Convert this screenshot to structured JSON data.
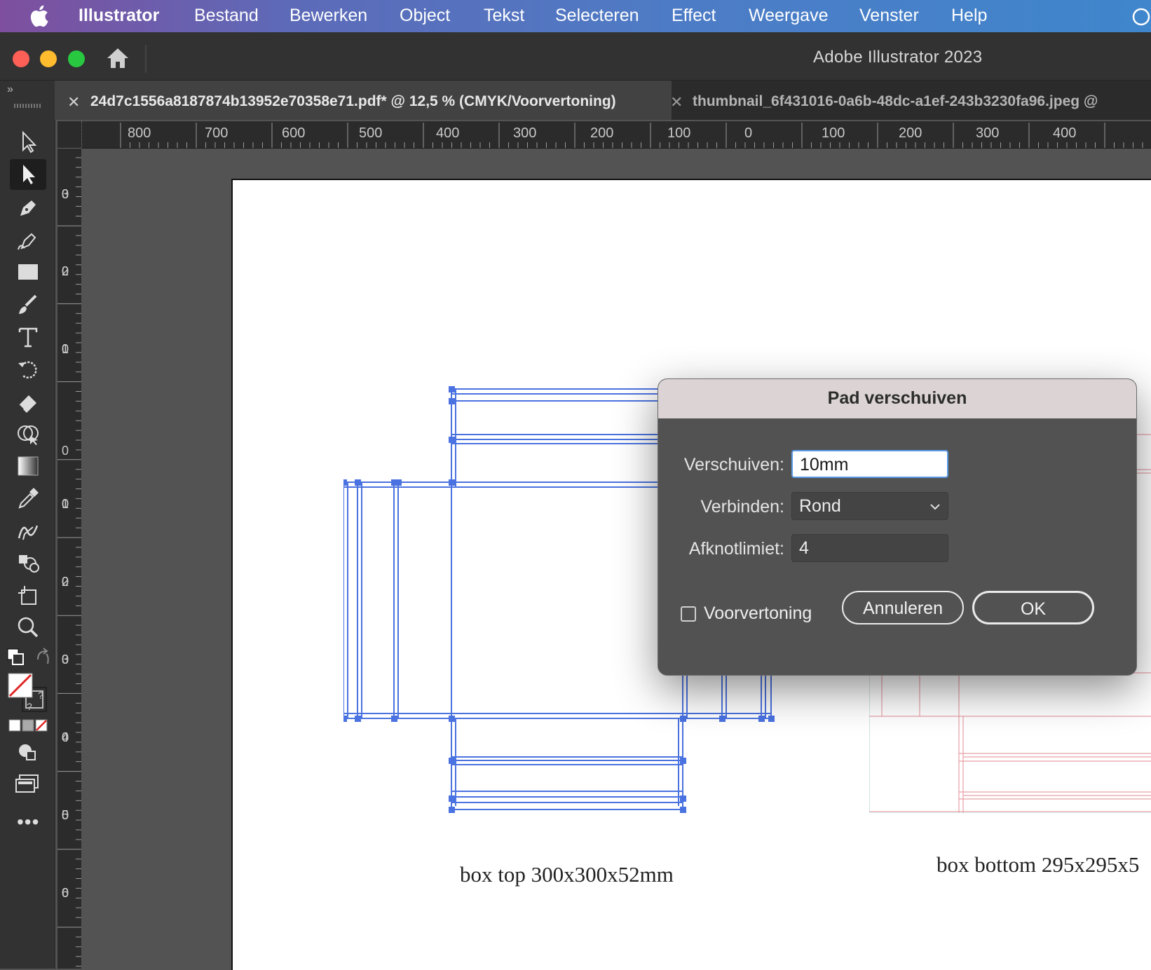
{
  "menubar": {
    "app_name": "Illustrator",
    "items": [
      "Bestand",
      "Bewerken",
      "Object",
      "Tekst",
      "Selecteren",
      "Effect",
      "Weergave",
      "Venster",
      "Help"
    ]
  },
  "window": {
    "title": "Adobe Illustrator 2023"
  },
  "tabs": [
    {
      "label": "24d7c1556a8187874b13952e70358e71.pdf* @ 12,5 % (CMYK/Voorvertoning)",
      "active": true
    },
    {
      "label": "thumbnail_6f431016-0a6b-48dc-a1ef-243b3230fa96.jpeg @",
      "active": false
    }
  ],
  "ruler": {
    "horizontal": [
      "800",
      "700",
      "600",
      "500",
      "400",
      "300",
      "200",
      "100",
      "0",
      "100",
      "200",
      "300",
      "400"
    ],
    "vertical": [
      "300",
      "200",
      "100",
      "0",
      "100",
      "200",
      "300",
      "400",
      "500",
      "600"
    ]
  },
  "artboard": {
    "caption_top": "box top 300x300x52mm",
    "caption_bottom": "box bottom 295x295x5"
  },
  "dialog": {
    "title": "Pad verschuiven",
    "offset_label": "Verschuiven:",
    "offset_value": "10mm",
    "join_label": "Verbinden:",
    "join_value": "Rond",
    "miter_label": "Afknotlimiet:",
    "miter_value": "4",
    "preview_label": "Voorvertoning",
    "preview_checked": false,
    "cancel_label": "Annuleren",
    "ok_label": "OK"
  },
  "colors": {
    "selection": "#4a72e0",
    "dieline": "#e8a0a8"
  }
}
